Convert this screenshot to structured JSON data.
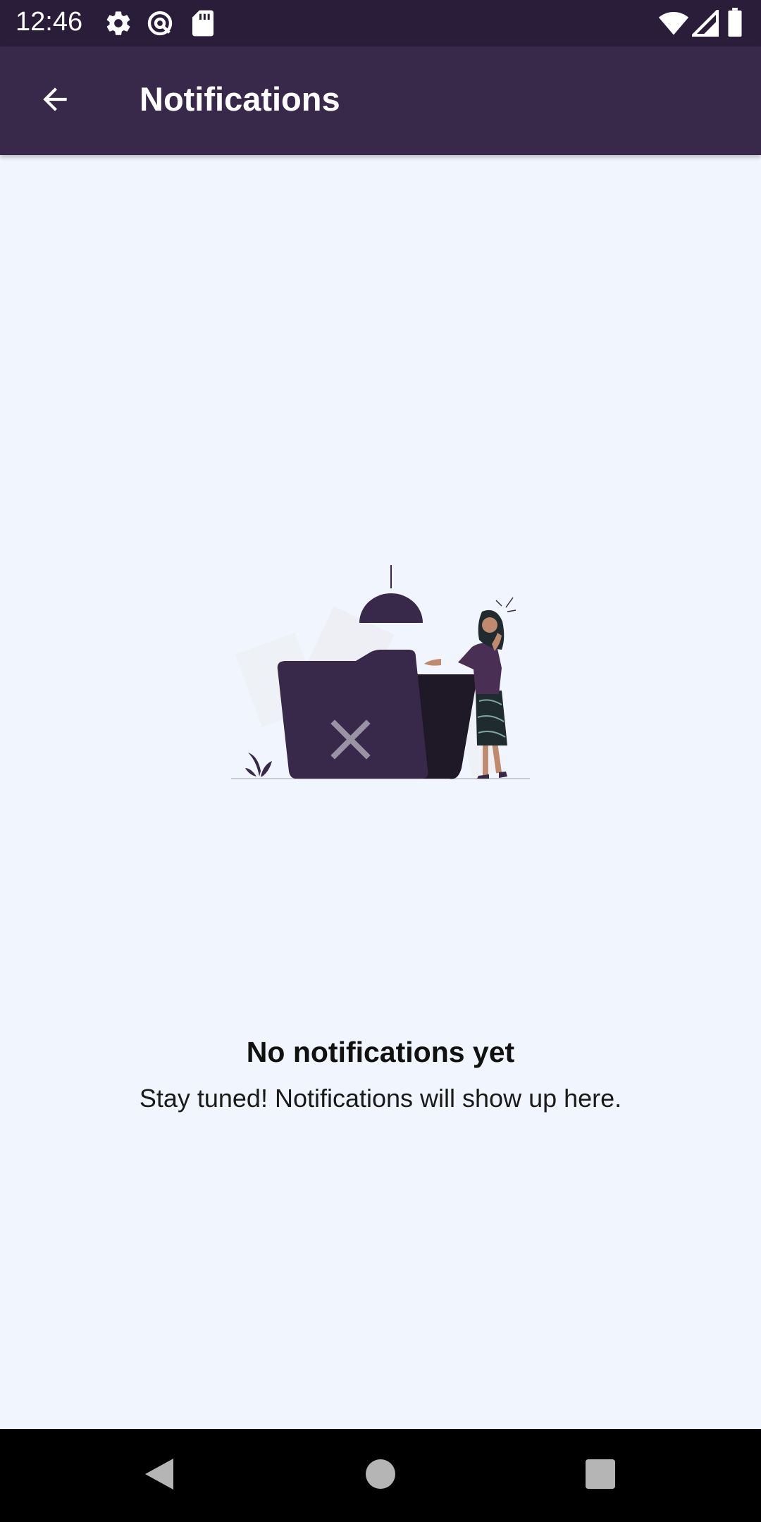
{
  "status_bar": {
    "time": "12:46",
    "left_icons": [
      "settings-icon",
      "sync-icon",
      "sd-card-icon"
    ],
    "right_icons": [
      "wifi-icon",
      "signal-icon",
      "battery-icon"
    ]
  },
  "app_bar": {
    "title": "Notifications",
    "back_icon": "arrow-back-icon",
    "background": "#38284a"
  },
  "empty_state": {
    "illustration": "empty-folder-illustration",
    "title": "No notifications yet",
    "subtitle": "Stay tuned! Notifications will show up here."
  },
  "nav_bar": {
    "buttons": [
      "back-triangle-icon",
      "home-circle-icon",
      "recents-square-icon"
    ]
  },
  "colors": {
    "status_bar": "#2a1d3a",
    "accent_dark": "#38284a",
    "page_background": "#f1f5fe"
  }
}
